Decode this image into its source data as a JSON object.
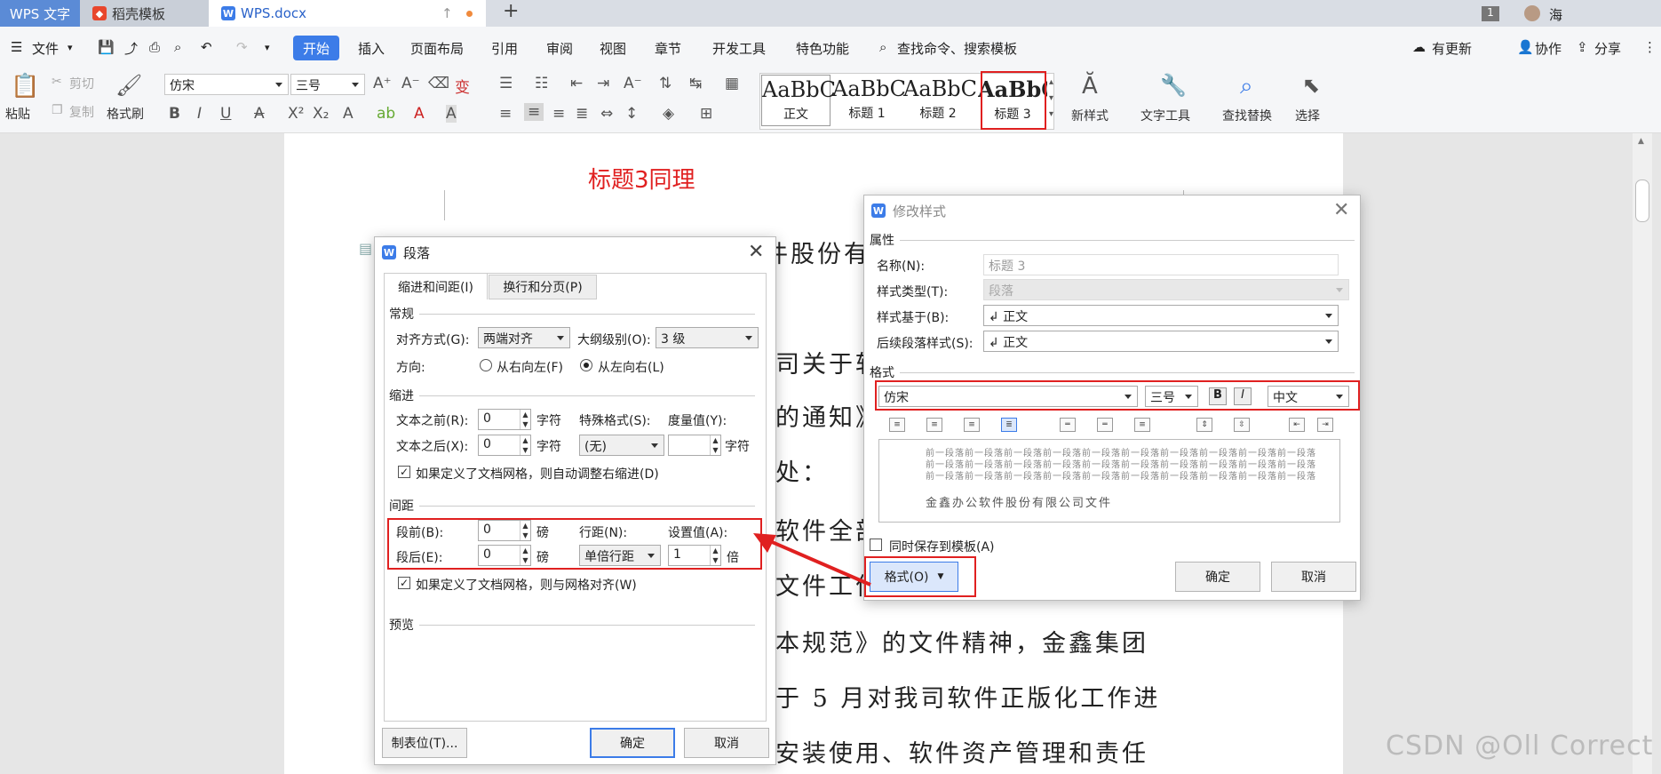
{
  "tabs": {
    "app": "WPS 文字",
    "template": "稻壳模板",
    "file": "WPS.docx",
    "add": "+",
    "badge": "1",
    "user": "海"
  },
  "menu": {
    "file": "文件",
    "items": [
      "开始",
      "插入",
      "页面布局",
      "引用",
      "审阅",
      "视图",
      "章节",
      "开发工具",
      "特色功能"
    ],
    "search": "查找命令、搜索模板",
    "update": "有更新",
    "collab": "协作",
    "share": "分享"
  },
  "ribbon": {
    "paste": "粘贴",
    "cut": "剪切",
    "copy": "复制",
    "format_painter": "格式刷",
    "font": "仿宋",
    "size": "三号",
    "styles": [
      {
        "big": "AaBbC",
        "label": "正文"
      },
      {
        "big": "AaBbC",
        "label": "标题 1"
      },
      {
        "big": "AaBbC",
        "label": "标题 2"
      },
      {
        "big": "AaBbC",
        "label": "标题 3"
      }
    ],
    "new_style": "新样式",
    "text_tools": "文字工具",
    "find_replace": "查找替换",
    "select": "选择"
  },
  "doc": {
    "annotation": "标题3同理",
    "lines": [
      "件股份有",
      "司关于软",
      "的通知》",
      "处：",
      "软件全部",
      "文件工作",
      "本规范》的文件精神，金鑫集团",
      "于 5 月对我司软件正版化工作进",
      "安装使用、软件资产管理和责任"
    ],
    "watermark": "CSDN @Oll Correct"
  },
  "para_dialog": {
    "title": "段落",
    "tabs": [
      "缩进和间距(I)",
      "换行和分页(P)"
    ],
    "general": "常规",
    "align_label": "对齐方式(G):",
    "align_value": "两端对齐",
    "outline_label": "大纲级别(O):",
    "outline_value": "3 级",
    "direction_label": "方向:",
    "rtl": "从右向左(F)",
    "ltr": "从左向右(L)",
    "indent": "缩进",
    "before_text": "文本之前(R):",
    "before_val": "0",
    "unit_char": "字符",
    "special": "特殊格式(S):",
    "measure": "度量值(Y):",
    "after_text": "文本之后(X):",
    "after_val": "0",
    "special_value": "(无)",
    "grid_indent": "如果定义了文档网格，则自动调整右缩进(D)",
    "spacing": "间距",
    "space_before": "段前(B):",
    "space_before_val": "0",
    "unit_pt": "磅",
    "line_spacing": "行距(N):",
    "set_value": "设置值(A):",
    "space_after": "段后(E):",
    "space_after_val": "0",
    "line_value": "单倍行距",
    "set_val": "1",
    "unit_times": "倍",
    "grid_align": "如果定义了文档网格，则与网格对齐(W)",
    "preview": "预览",
    "tabstops": "制表位(T)...",
    "ok": "确定",
    "cancel": "取消"
  },
  "style_dialog": {
    "title": "修改样式",
    "props": "属性",
    "name_label": "名称(N):",
    "name_value": "标题 3",
    "type_label": "样式类型(T):",
    "type_value": "段落",
    "based_label": "样式基于(B):",
    "based_value": "↲ 正文",
    "next_label": "后续段落样式(S):",
    "next_value": "↲ 正文",
    "format": "格式",
    "font": "仿宋",
    "size": "三号",
    "bold": "B",
    "italic": "I",
    "lang": "中文",
    "preview_prev": "前一段落前一段落前一段落前一段落前一段落前一段落前一段落前一段落前一段落前一段落",
    "preview_sample": "金鑫办公软件股份有限公司文件",
    "save_template": "同时保存到模板(A)",
    "format_btn": "格式(O)",
    "ok": "确定",
    "cancel": "取消"
  }
}
